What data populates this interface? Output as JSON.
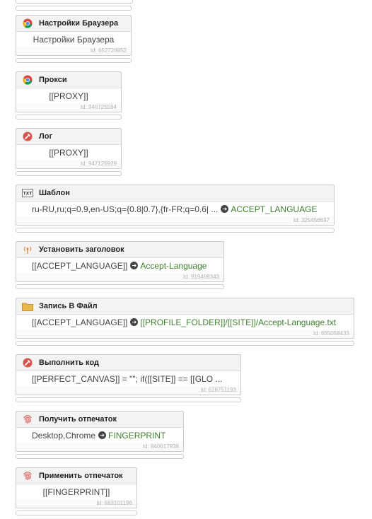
{
  "nodes": [
    {
      "title": "Настройки Браузера",
      "body": "Настройки Браузера",
      "id": "Id: 652728852"
    },
    {
      "title": "Прокси",
      "body": "[[PROXY]]",
      "id": "Id: 940725594"
    },
    {
      "title": "Лог",
      "body": "[[PROXY]]",
      "id": "Id: 947126929"
    },
    {
      "title": "Шаблон",
      "body": "ru-RU,ru;q=0.9,en-US;q={0.8|0.7},{fr-FR;q=0.6| ...",
      "target": "ACCEPT_LANGUAGE",
      "id": "Id: 325456697"
    },
    {
      "title": "Установить заголовок",
      "body": "[[ACCEPT_LANGUAGE]]",
      "target": "Accept-Language",
      "id": "Id: 919498343"
    },
    {
      "title": "Запись В Файл",
      "body": "[[ACCEPT_LANGUAGE]]",
      "target": "[[PROFILE_FOLDER]]/[[SITE]]/Accept-Language.txt",
      "id": "Id: 655058433"
    },
    {
      "title": "Выполнить код",
      "body": "[[PERFECT_CANVAS]] = \"\"; if([[SITE]] == [[GLO ...",
      "id": "Id: 628751193"
    },
    {
      "title": "Получить отпечаток",
      "body": "Desktop,Chrome",
      "target": "FINGERPRINT",
      "id": "Id: 840617938"
    },
    {
      "title": "Применить отпечаток",
      "body": "[[FINGERPRINT]]",
      "id": "Id: 683101196"
    }
  ],
  "icons": {
    "chrome": "chrome-icon",
    "code": "code-icon",
    "template": "txt-template-icon",
    "header": "antenna-icon",
    "folder": "folder-icon",
    "fingerprint": "fingerprint-icon"
  },
  "colors": {
    "variable": "#3f7f2f",
    "icon_red": "#d9534f",
    "folder": "#e8b84a"
  }
}
